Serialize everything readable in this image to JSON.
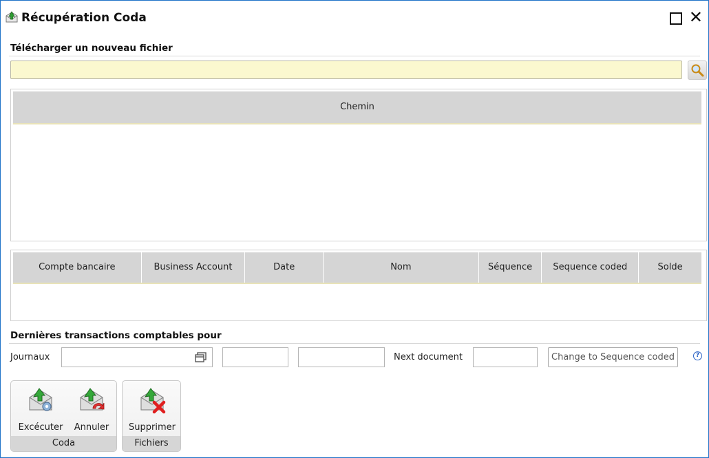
{
  "window": {
    "title": "Récupération Coda"
  },
  "upload": {
    "section_label": "Télécharger un nouveau fichier",
    "value": ""
  },
  "files_grid": {
    "columns": [
      "Chemin"
    ]
  },
  "coda_grid": {
    "columns": [
      "Compte bancaire",
      "Business Account",
      "Date",
      "Nom",
      "Séquence",
      "Sequence coded",
      "Solde"
    ]
  },
  "transactions": {
    "section_label": "Dernières transactions comptables pour",
    "journaux_label": "Journaux",
    "journaux_value": "",
    "field2_value": "",
    "field3_value": "",
    "next_document_label": "Next document",
    "next_document_value": "",
    "change_button_label": "Change to Sequence coded",
    "help_glyph": "?"
  },
  "ribbon": {
    "groups": [
      {
        "label": "Coda",
        "buttons": [
          {
            "label": "Excécuter",
            "icon": "execute-envelope-icon"
          },
          {
            "label": "Annuler",
            "icon": "cancel-envelope-icon"
          }
        ]
      },
      {
        "label": "Fichiers",
        "buttons": [
          {
            "label": "Supprimer",
            "icon": "delete-envelope-icon"
          }
        ]
      }
    ]
  },
  "colors": {
    "frame_border": "#1e73c8",
    "input_yellow": "#fbf8cf",
    "grid_header": "#d5d5d5",
    "accent_green": "#2f9e33",
    "accent_red": "#e02020"
  }
}
